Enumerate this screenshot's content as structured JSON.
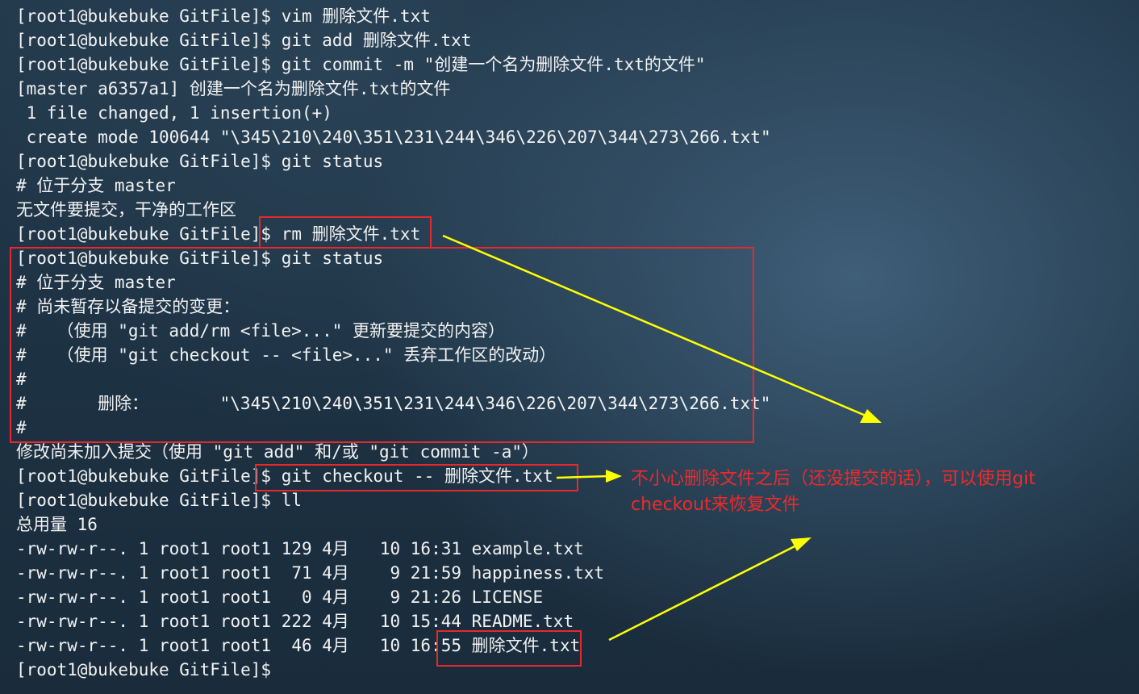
{
  "terminal": {
    "lines": [
      "[root1@bukebuke GitFile]$ vim 删除文件.txt",
      "[root1@bukebuke GitFile]$ git add 删除文件.txt",
      "[root1@bukebuke GitFile]$ git commit -m \"创建一个名为删除文件.txt的文件\"",
      "[master a6357a1] 创建一个名为删除文件.txt的文件",
      " 1 file changed, 1 insertion(+)",
      " create mode 100644 \"\\345\\210\\240\\351\\231\\244\\346\\226\\207\\344\\273\\266.txt\"",
      "[root1@bukebuke GitFile]$ git status",
      "# 位于分支 master",
      "无文件要提交，干净的工作区",
      "[root1@bukebuke GitFile]$ rm 删除文件.txt",
      "[root1@bukebuke GitFile]$ git status",
      "# 位于分支 master",
      "# 尚未暂存以备提交的变更：",
      "#   （使用 \"git add/rm <file>...\" 更新要提交的内容）",
      "#   （使用 \"git checkout -- <file>...\" 丢弃工作区的改动）",
      "#",
      "#       删除：       \"\\345\\210\\240\\351\\231\\244\\346\\226\\207\\344\\273\\266.txt\"",
      "#",
      "修改尚未加入提交（使用 \"git add\" 和/或 \"git commit -a\"）",
      "[root1@bukebuke GitFile]$ git checkout -- 删除文件.txt",
      "[root1@bukebuke GitFile]$ ll",
      "总用量 16",
      "-rw-rw-r--. 1 root1 root1 129 4月   10 16:31 example.txt",
      "-rw-rw-r--. 1 root1 root1  71 4月    9 21:59 happiness.txt",
      "-rw-rw-r--. 1 root1 root1   0 4月    9 21:26 LICENSE",
      "-rw-rw-r--. 1 root1 root1 222 4月   10 15:44 README.txt",
      "-rw-rw-r--. 1 root1 root1  46 4月   10 16:55 删除文件.txt",
      "[root1@bukebuke GitFile]$"
    ]
  },
  "annotation": {
    "text": "不小心删除文件之后（还没提交的话），可以使用git checkout来恢复文件"
  },
  "colors": {
    "terminal_text": "#f2f2f2",
    "highlight_box": "#e8282b",
    "arrow": "#ffff00",
    "annotation_text": "#ee2a2a"
  }
}
